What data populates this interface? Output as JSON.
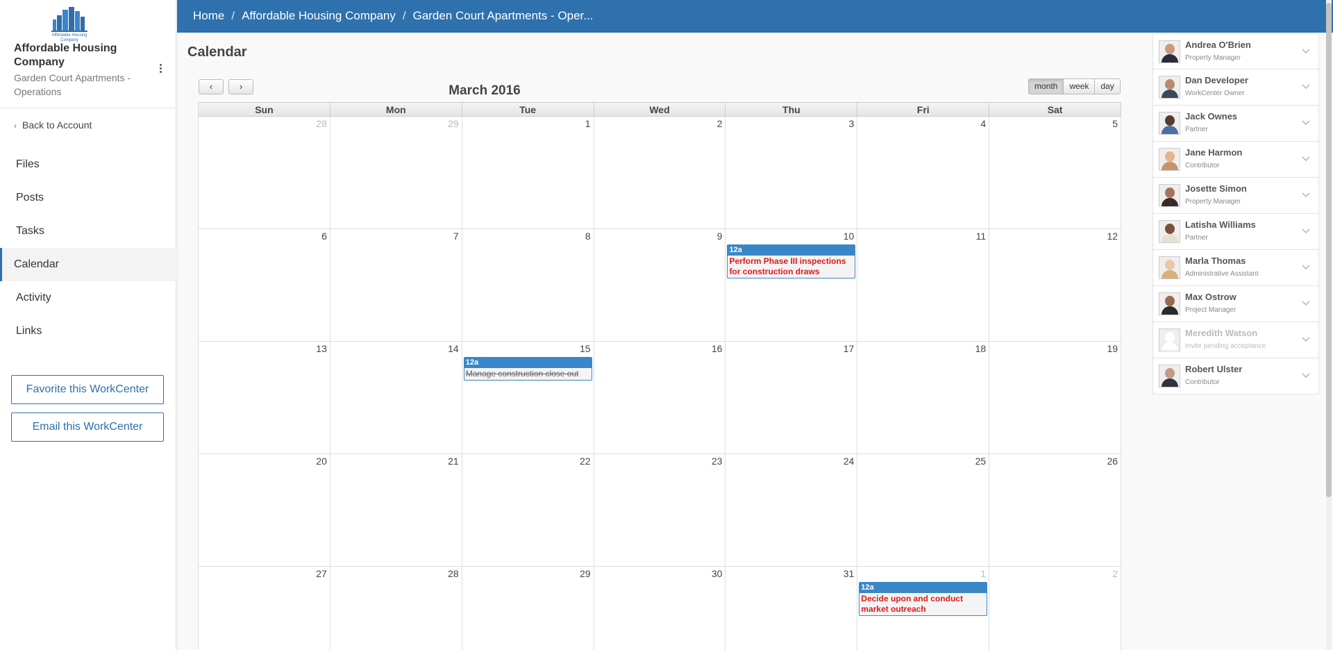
{
  "breadcrumb": [
    "Home",
    "Affordable Housing Company",
    "Garden Court Apartments - Oper..."
  ],
  "sidebar": {
    "logo_text": "Affordable Housing Company",
    "org_name": "Affordable Housing Company",
    "org_sub": "Garden Court Apartments - Operations",
    "back_label": "Back to Account",
    "nav": [
      {
        "label": "Files",
        "active": false
      },
      {
        "label": "Posts",
        "active": false
      },
      {
        "label": "Tasks",
        "active": false
      },
      {
        "label": "Calendar",
        "active": true
      },
      {
        "label": "Activity",
        "active": false
      },
      {
        "label": "Links",
        "active": false
      }
    ],
    "favorite_label": "Favorite this WorkCenter",
    "email_label": "Email this WorkCenter"
  },
  "calendar": {
    "page_title": "Calendar",
    "prev_label": "‹",
    "next_label": "›",
    "title": "March 2016",
    "views": [
      {
        "label": "month",
        "active": true
      },
      {
        "label": "week",
        "active": false
      },
      {
        "label": "day",
        "active": false
      }
    ],
    "weekdays": [
      "Sun",
      "Mon",
      "Tue",
      "Wed",
      "Thu",
      "Fri",
      "Sat"
    ],
    "weeks": [
      [
        {
          "d": "28",
          "other": true
        },
        {
          "d": "29",
          "other": true
        },
        {
          "d": "1"
        },
        {
          "d": "2"
        },
        {
          "d": "3"
        },
        {
          "d": "4"
        },
        {
          "d": "5"
        }
      ],
      [
        {
          "d": "6"
        },
        {
          "d": "7"
        },
        {
          "d": "8"
        },
        {
          "d": "9"
        },
        {
          "d": "10",
          "event": {
            "time": "12a",
            "title": "Perform Phase III inspections for construction draws",
            "done": false
          }
        },
        {
          "d": "11"
        },
        {
          "d": "12"
        }
      ],
      [
        {
          "d": "13"
        },
        {
          "d": "14"
        },
        {
          "d": "15",
          "event": {
            "time": "12a",
            "title": "Manage construction close out",
            "done": true
          }
        },
        {
          "d": "16"
        },
        {
          "d": "17"
        },
        {
          "d": "18"
        },
        {
          "d": "19"
        }
      ],
      [
        {
          "d": "20"
        },
        {
          "d": "21"
        },
        {
          "d": "22"
        },
        {
          "d": "23"
        },
        {
          "d": "24"
        },
        {
          "d": "25"
        },
        {
          "d": "26"
        }
      ],
      [
        {
          "d": "27"
        },
        {
          "d": "28"
        },
        {
          "d": "29"
        },
        {
          "d": "30"
        },
        {
          "d": "31"
        },
        {
          "d": "1",
          "other": true,
          "event": {
            "time": "12a",
            "title": "Decide upon and conduct market outreach",
            "done": false
          }
        },
        {
          "d": "2",
          "other": true
        }
      ]
    ]
  },
  "members": [
    {
      "name": "Andrea O'Brien",
      "role": "Property Manager",
      "skin": "#c99a7f",
      "shirt": "#2b2b3a",
      "pending": false
    },
    {
      "name": "Dan Developer",
      "role": "WorkCenter Owner",
      "skin": "#b98a70",
      "shirt": "#3a4a5a",
      "pending": false
    },
    {
      "name": "Jack Ownes",
      "role": "Partner",
      "skin": "#5a3a2a",
      "shirt": "#4a6fa0",
      "pending": false
    },
    {
      "name": "Jane Harmon",
      "role": "Contributor",
      "skin": "#e2b58f",
      "shirt": "#c8946a",
      "pending": false
    },
    {
      "name": "Josette Simon",
      "role": "Property Manager",
      "skin": "#a8735a",
      "shirt": "#3a2a2a",
      "pending": false
    },
    {
      "name": "Latisha Williams",
      "role": "Partner",
      "skin": "#7a5038",
      "shirt": "#e8e0d0",
      "pending": false
    },
    {
      "name": "Marla Thomas",
      "role": "Administrative Assistant",
      "skin": "#ebc7a5",
      "shirt": "#d8b07a",
      "pending": false
    },
    {
      "name": "Max Ostrow",
      "role": "Project Manager",
      "skin": "#9a6a50",
      "shirt": "#2a2a2a",
      "pending": false
    },
    {
      "name": "Meredith Watson",
      "role": "Invite pending acceptance",
      "skin": "#e6e6e6",
      "shirt": "#e6e6e6",
      "pending": true
    },
    {
      "name": "Robert Ulster",
      "role": "Contributor",
      "skin": "#c89a80",
      "shirt": "#2e3440",
      "pending": false
    }
  ],
  "colors": {
    "header": "#2e71ad",
    "event_border": "#3a87c8",
    "event_title": "#e0181b",
    "accent": "#2f6fa9"
  }
}
